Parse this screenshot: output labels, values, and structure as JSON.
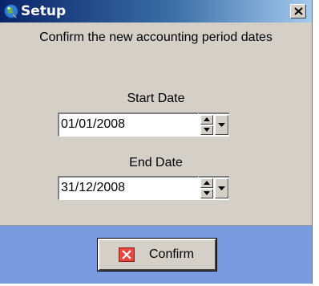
{
  "window": {
    "title": "Setup",
    "icon": "app-globe-icon",
    "close_icon": "close-icon"
  },
  "instruction": "Confirm the new accounting period dates",
  "start_date": {
    "label": "Start Date",
    "value": "01/01/2008"
  },
  "end_date": {
    "label": "End Date",
    "value": "31/12/2008"
  },
  "footer": {
    "confirm_label": "Confirm",
    "confirm_icon": "red-x-icon"
  },
  "colors": {
    "titlebar_start": "#0a246a",
    "titlebar_end": "#a6caf0",
    "dialog_bg": "#d4d0c8",
    "footer_bg": "#7a9be0",
    "confirm_icon_red": "#e8453c"
  }
}
